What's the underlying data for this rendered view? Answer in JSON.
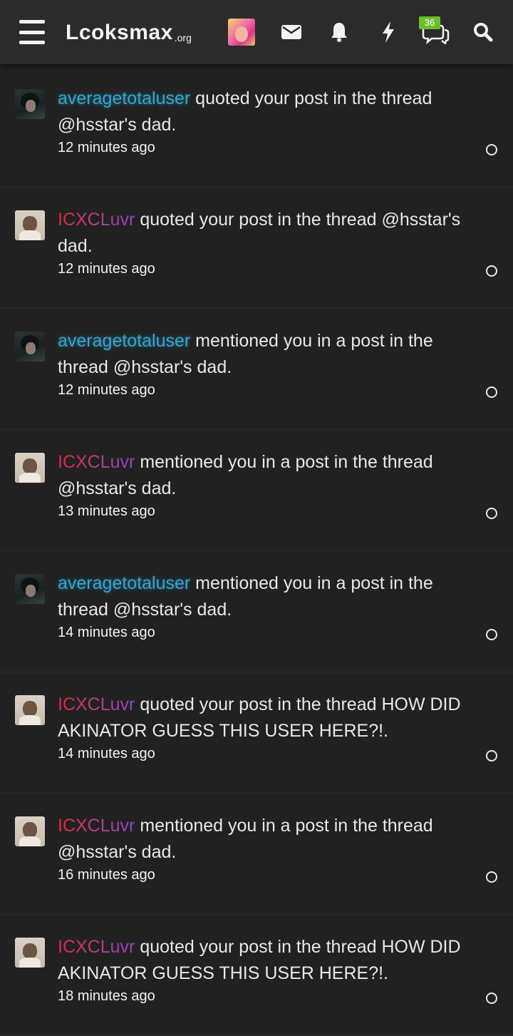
{
  "header": {
    "logo_text": "Lcoksmax",
    "logo_suffix": ".org",
    "conversations_badge": "36",
    "icons": [
      "menu-icon",
      "account-avatar",
      "mail-icon",
      "bell-icon",
      "bolt-icon",
      "chat-icon",
      "search-icon"
    ]
  },
  "notifications": [
    {
      "user": "averagetotaluser",
      "user_style": "a",
      "message": " quoted your post in the thread @hsstar's dad.",
      "time": "12 minutes ago"
    },
    {
      "user": "ICXCLuvr",
      "user_style": "b",
      "message": " quoted your post in the thread @hsstar's dad.",
      "time": "12 minutes ago"
    },
    {
      "user": "averagetotaluser",
      "user_style": "a",
      "message": " mentioned you in a post in the thread @hsstar's dad.",
      "time": "12 minutes ago"
    },
    {
      "user": "ICXCLuvr",
      "user_style": "b",
      "message": " mentioned you in a post in the thread @hsstar's dad.",
      "time": "13 minutes ago"
    },
    {
      "user": "averagetotaluser",
      "user_style": "a",
      "message": " mentioned you in a post in the thread @hsstar's dad.",
      "time": "14 minutes ago"
    },
    {
      "user": "ICXCLuvr",
      "user_style": "b",
      "message": " quoted your post in the thread HOW DID AKINATOR GUESS THIS USER HERE?!.",
      "time": "14 minutes ago"
    },
    {
      "user": "ICXCLuvr",
      "user_style": "b",
      "message": " mentioned you in a post in the thread @hsstar's dad.",
      "time": "16 minutes ago"
    },
    {
      "user": "ICXCLuvr",
      "user_style": "b",
      "message": " quoted your post in the thread HOW DID AKINATOR GUESS THIS USER HERE?!.",
      "time": "18 minutes ago"
    }
  ]
}
